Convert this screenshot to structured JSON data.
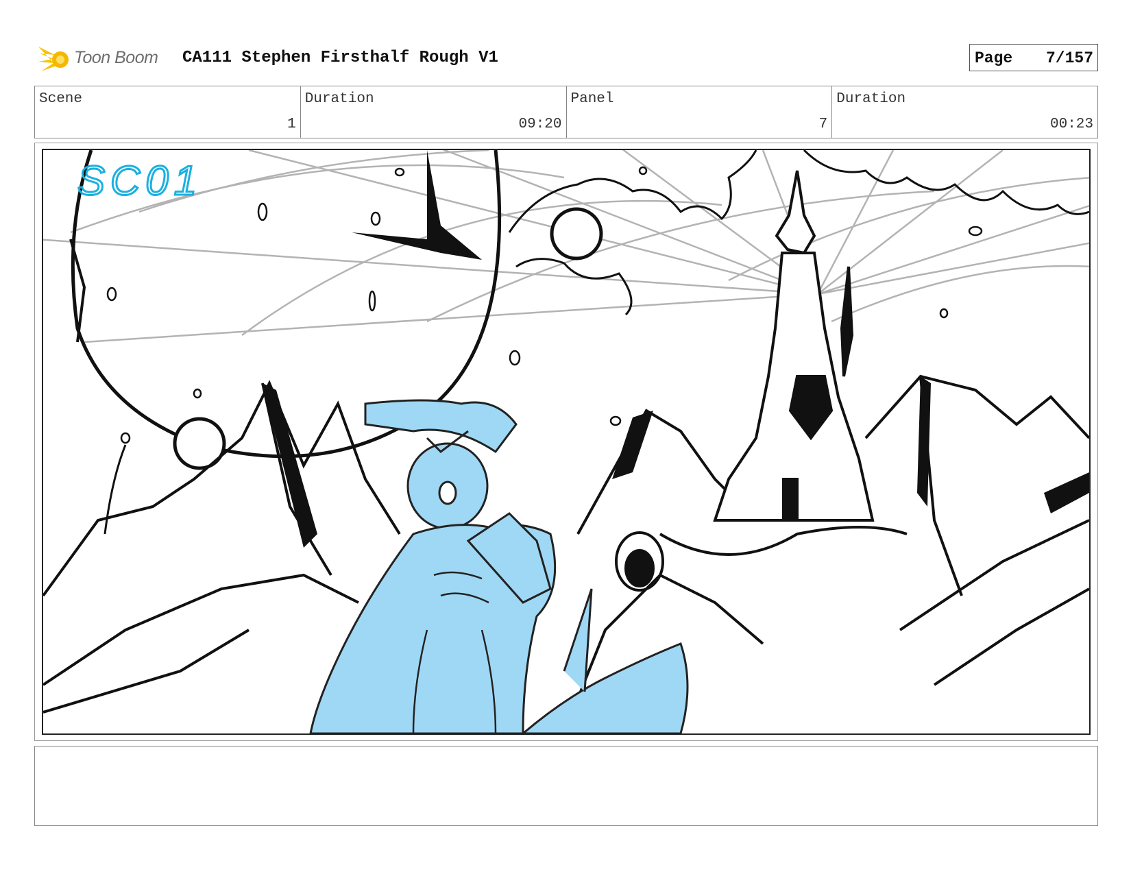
{
  "header": {
    "logo_text": "Toon Boom",
    "title": "CA111 Stephen Firsthalf Rough V1",
    "page_label": "Page",
    "page_value": "7/157"
  },
  "info": {
    "scene_label": "Scene",
    "scene_value": "1",
    "scene_duration_label": "Duration",
    "scene_duration_value": "09:20",
    "panel_label": "Panel",
    "panel_value": "7",
    "panel_duration_label": "Duration",
    "panel_duration_value": "00:23"
  },
  "panel": {
    "sketch_annotation": "SC01"
  },
  "colors": {
    "character_fill": "#9fd8f5",
    "annotation": "#1ab0e0",
    "logo_accent": "#f5c400"
  }
}
